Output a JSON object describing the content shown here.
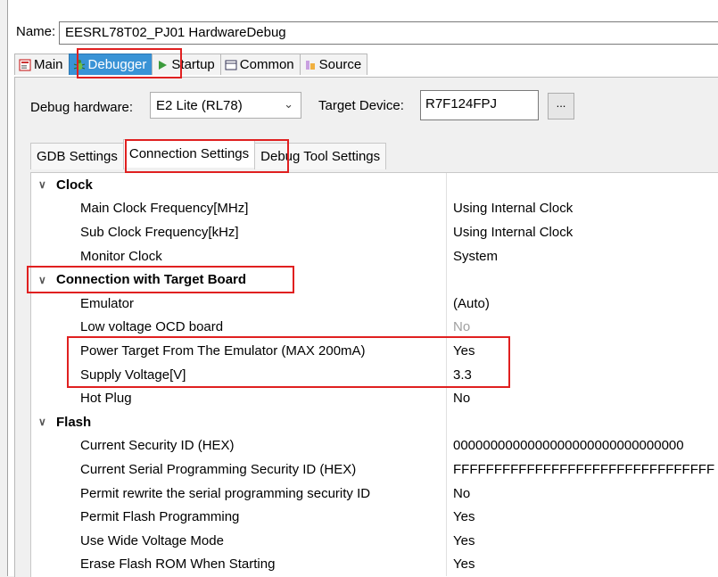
{
  "name_label": "Name:",
  "config_name": "EESRL78T02_PJ01 HardwareDebug",
  "tabs": [
    {
      "label": "Main",
      "icon": "main-tab-icon"
    },
    {
      "label": "Debugger",
      "icon": "bug-icon"
    },
    {
      "label": "Startup",
      "icon": "play-icon"
    },
    {
      "label": "Common",
      "icon": "common-icon"
    },
    {
      "label": "Source",
      "icon": "source-icon"
    }
  ],
  "debug_hw_label": "Debug hardware:",
  "debug_hw_value": "E2 Lite (RL78)",
  "target_device_label": "Target Device:",
  "target_device_value": "R7F124FPJ",
  "browse_label": "...",
  "subtabs": [
    "GDB Settings",
    "Connection Settings",
    "Debug Tool Settings"
  ],
  "rows": [
    {
      "cat": true,
      "label": "Clock",
      "value": ""
    },
    {
      "label": "Main Clock Frequency[MHz]",
      "value": "Using Internal Clock"
    },
    {
      "label": "Sub Clock Frequency[kHz]",
      "value": "Using Internal Clock"
    },
    {
      "label": "Monitor Clock",
      "value": "System"
    },
    {
      "cat": true,
      "label": "Connection with Target Board",
      "value": ""
    },
    {
      "label": "Emulator",
      "value": "(Auto)"
    },
    {
      "label": "Low voltage OCD board",
      "value": "No",
      "grey": true
    },
    {
      "label": "Power Target From The Emulator (MAX 200mA)",
      "value": "Yes"
    },
    {
      "label": "Supply Voltage[V]",
      "value": "3.3"
    },
    {
      "label": "Hot Plug",
      "value": "No"
    },
    {
      "cat": true,
      "label": "Flash",
      "value": ""
    },
    {
      "label": "Current Security ID (HEX)",
      "value": "0000000000000000000000000000000"
    },
    {
      "label": "Current Serial Programming Security ID (HEX)",
      "value": "FFFFFFFFFFFFFFFFFFFFFFFFFFFFFFFF"
    },
    {
      "label": "Permit rewrite the serial programming security ID",
      "value": "No"
    },
    {
      "label": "Permit Flash Programming",
      "value": "Yes"
    },
    {
      "label": "Use Wide Voltage Mode",
      "value": "Yes"
    },
    {
      "label": "Erase Flash ROM When Starting",
      "value": "Yes"
    }
  ],
  "highlight_color": "#e02020",
  "active_tab_color": "#3993d6"
}
